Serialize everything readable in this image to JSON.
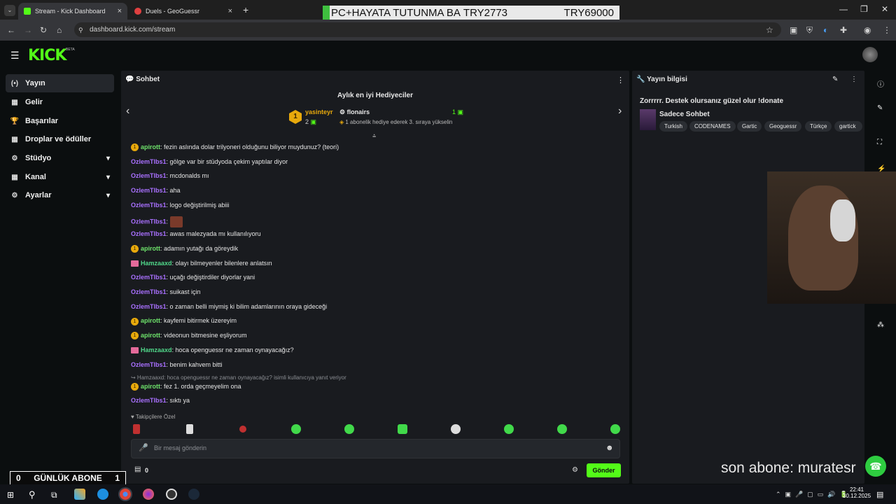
{
  "browser": {
    "tabs": [
      {
        "label": "Stream - Kick Dashboard",
        "close": "×"
      },
      {
        "label": "Duels - GeoGuessr",
        "close": "×"
      }
    ],
    "new_tab": "+",
    "url": "dashboard.kick.com/stream",
    "overlay_text_left": "PC+HAYATA TUTUNMA BA",
    "overlay_text_mid": "TRY2773",
    "overlay_text_right": "TRY69000"
  },
  "app": {
    "logo": "KICK",
    "beta": "BETA"
  },
  "sidebar": {
    "items": [
      {
        "label": "Yayın",
        "icon": "(•)"
      },
      {
        "label": "Gelir",
        "icon": "▦"
      },
      {
        "label": "Başarılar",
        "icon": "🏆"
      },
      {
        "label": "Droplar ve ödüller",
        "icon": "▦"
      },
      {
        "label": "Stüdyo",
        "icon": "⚙"
      },
      {
        "label": "Kanal",
        "icon": "▦"
      },
      {
        "label": "Ayarlar",
        "icon": "⚙"
      }
    ]
  },
  "chat": {
    "title": "Sohbet",
    "gifters_title": "Aylık en iyi Hediyeciler",
    "gifter1": {
      "rank": "1",
      "name": "yasinteyr",
      "count": "2"
    },
    "gifter2": {
      "name": "flonairs",
      "count": "1",
      "note": "1 abonelik hediye ederek 3. sıraya yükselin"
    },
    "messages": [
      {
        "badge": "y",
        "user": "apirott",
        "cls": "u1",
        "text": ": fezin aslında dolar trilyoneri olduğunu biliyor muydunuz? (teori)"
      },
      {
        "badge": "",
        "user": "OzlemTlbs1",
        "cls": "u2",
        "text": ": gölge var bir stüdyoda çekim yaptılar diyor"
      },
      {
        "badge": "",
        "user": "OzlemTlbs1",
        "cls": "u2",
        "text": ": mcdonalds mı"
      },
      {
        "badge": "",
        "user": "OzlemTlbs1",
        "cls": "u2",
        "text": ": aha"
      },
      {
        "badge": "",
        "user": "OzlemTlbs1",
        "cls": "u2",
        "text": ": logo değiştirilmiş abiii"
      },
      {
        "badge": "",
        "user": "OzlemTlbs1",
        "cls": "u2",
        "text": ": ",
        "emote": true
      },
      {
        "badge": "",
        "user": "OzlemTlbs1",
        "cls": "u2",
        "text": ": awas malezyada mı kullanılıyoru"
      },
      {
        "badge": "y",
        "user": "apirott",
        "cls": "u1",
        "text": ": adamın yutağı da göreydik"
      },
      {
        "badge": "c",
        "user": "Hamzaaxd",
        "cls": "u3",
        "text": ": olayı bilmeyenler bilenlere anlatsın"
      },
      {
        "badge": "",
        "user": "OzlemTlbs1",
        "cls": "u2",
        "text": ": uçağı değiştirdiler diyorlar yani"
      },
      {
        "badge": "",
        "user": "OzlemTlbs1",
        "cls": "u2",
        "text": ": suikast için"
      },
      {
        "badge": "",
        "user": "OzlemTlbs1",
        "cls": "u2",
        "text": ": o zaman belli miymiş ki bilim adamlarının oraya gideceği"
      },
      {
        "badge": "y",
        "user": "apirott",
        "cls": "u1",
        "text": ": kayfemi bitirmek üzereyim"
      },
      {
        "badge": "y",
        "user": "apirott",
        "cls": "u1",
        "text": ": videonun bitmesine eşliyorum"
      },
      {
        "badge": "c",
        "user": "Hamzaaxd",
        "cls": "u3",
        "text": ": hoca openguessr ne zaman oynayacağız?"
      },
      {
        "badge": "",
        "user": "OzlemTlbs1",
        "cls": "u2",
        "text": ": benim kahvem bitti"
      }
    ],
    "reply_note": "↪ Hamzaaxd: hoca openguessr ne zaman oynayacağız? isimli kullanıcıya yanıt veriyor",
    "messages2": [
      {
        "badge": "y",
        "user": "apirott",
        "cls": "u1",
        "text": ": fez 1. orda geçmeyelim ona"
      },
      {
        "badge": "",
        "user": "OzlemTlbs1",
        "cls": "u2",
        "text": ": sıktı ya"
      }
    ],
    "followers_only": "Takipçilere Özel",
    "input_placeholder": "Bir mesaj gönderin",
    "points": "0",
    "send_label": "Gönder"
  },
  "info": {
    "title": "Yayın bilgisi",
    "stream_title": "Zorrrrr. Destek olursanız güzel olur !donate",
    "category": "Sadece Sohbet",
    "tags": [
      "Turkish",
      "CODENAMES",
      "Gartic",
      "Geoguessr",
      "Türkçe",
      "gartick"
    ]
  },
  "overlays": {
    "abone_left": "0",
    "abone_label": "GÜNLÜK ABONE",
    "abone_right": "1",
    "son_abone": "son abone: muratesr"
  },
  "taskbar": {
    "time": "22:41",
    "date": "30.12.2025"
  },
  "colors": {
    "brand": "#53fc18",
    "panel": "#191b1f",
    "bg": "#0b0e0f"
  }
}
